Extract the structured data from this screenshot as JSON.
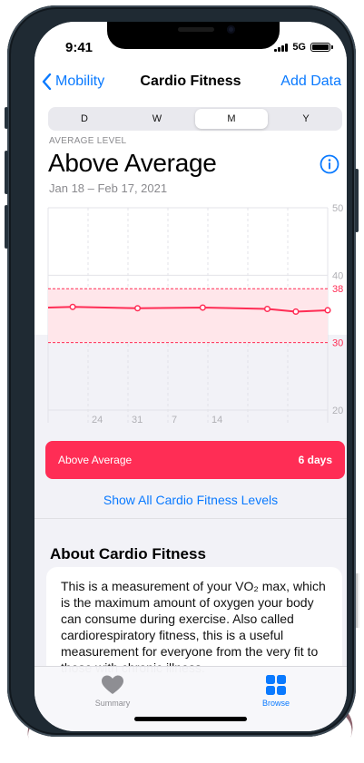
{
  "status": {
    "time": "9:41",
    "network": "5G"
  },
  "nav": {
    "back_label": "Mobility",
    "title": "Cardio Fitness",
    "action_label": "Add Data"
  },
  "segments": {
    "d": "D",
    "w": "W",
    "m": "M",
    "y": "Y",
    "selected": "M"
  },
  "summary": {
    "label": "AVERAGE LEVEL",
    "value": "Above Average",
    "date_range": "Jan 18 – Feb 17, 2021"
  },
  "chart_data": {
    "type": "line",
    "y_ticks": [
      "50",
      "40",
      "20"
    ],
    "y_range": [
      20,
      50
    ],
    "band": {
      "low": 30,
      "high": 38,
      "low_label": "30",
      "high_label": "38"
    },
    "x_ticks": [
      "24",
      "31",
      "7",
      "14"
    ],
    "series": [
      {
        "values": [
          35.2,
          35.3,
          35.1,
          35.2,
          35.0,
          34.6,
          34.8
        ]
      }
    ],
    "colors": {
      "line": "#ff2d55",
      "band": "#ffe6ea",
      "grid": "#e3e3e8"
    }
  },
  "legend": {
    "label": "Above Average",
    "count": "6 days",
    "color": "#ff2d55"
  },
  "show_all_label": "Show All Cardio Fitness Levels",
  "about": {
    "title": "About Cardio Fitness",
    "text": "This is a measurement of your VO₂ max, which is the maximum amount of oxygen your body can consume during exercise. Also called cardiorespiratory fitness, this is a useful measurement for everyone from the very fit to those with chronic illness."
  },
  "tabbar": {
    "summary_label": "Summary",
    "browse_label": "Browse"
  },
  "icons": {
    "back": "chevron-left-icon",
    "info": "info-circle-icon",
    "summary": "heart-icon",
    "browse": "grid-icon"
  },
  "colors": {
    "accent": "#0a7aff",
    "highlight": "#ff2d55"
  }
}
